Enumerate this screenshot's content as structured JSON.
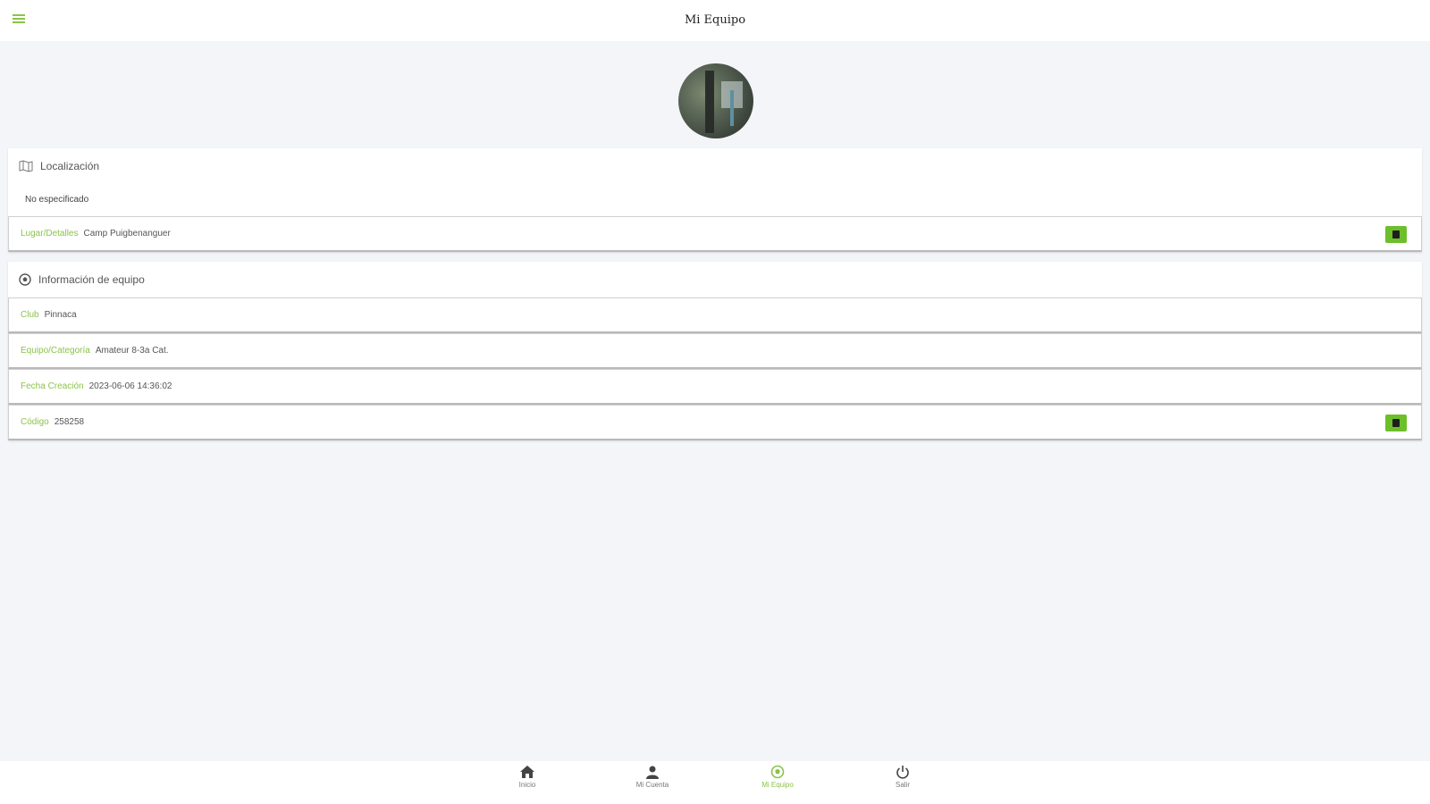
{
  "header": {
    "title": "Mi Equipo"
  },
  "location_card": {
    "title": "Localización",
    "subtext": "No especificado",
    "rows": [
      {
        "label": "Lugar/Detalles",
        "value": "Camp Puigbenanguer"
      }
    ]
  },
  "team_card": {
    "title": "Información de equipo",
    "rows": [
      {
        "label": "Club",
        "value": "Pinnaca"
      },
      {
        "label": "Equipo/Categoría",
        "value": "Amateur 8-3a Cat."
      },
      {
        "label": "Fecha Creación",
        "value": "2023-06-06 14:36:02"
      },
      {
        "label": "Código",
        "value": "258258"
      }
    ]
  },
  "tabs": [
    {
      "label": "Inicio",
      "icon": "home-icon",
      "active": false
    },
    {
      "label": "Mi Cuenta",
      "icon": "user-icon",
      "active": false
    },
    {
      "label": "Mi Equipo",
      "icon": "soccer-ball-icon",
      "active": true
    },
    {
      "label": "Salir",
      "icon": "power-icon",
      "active": false
    }
  ],
  "colors": {
    "accent": "#8bc34a",
    "button": "#6cbf2a",
    "background": "#f3f5f8"
  }
}
